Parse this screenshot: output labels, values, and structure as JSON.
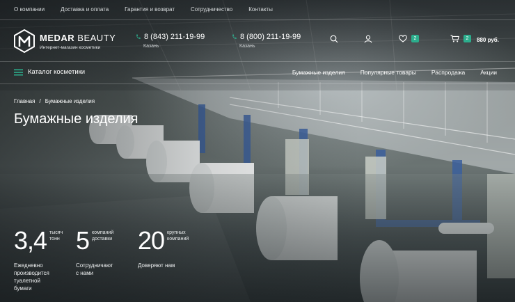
{
  "toplinks": [
    "О компании",
    "Доставка и оплата",
    "Гарантия и возврат",
    "Сотрудничество",
    "Контакты"
  ],
  "logo": {
    "name_bold": "MEDAR",
    "name_light": "BEAUTY",
    "tagline": "Интернет-магазин косметики"
  },
  "phones": [
    {
      "number": "8 (843) 211-19-99",
      "city": "Казань"
    },
    {
      "number": "8 (800) 211-19-99",
      "city": "Казань"
    }
  ],
  "header_icons": {
    "search": "search-icon",
    "account": "user-icon",
    "wishlist": "heart-icon",
    "cart": "cart-icon",
    "wishlist_count": "2",
    "cart_count": "2",
    "cart_total": "880 руб."
  },
  "catalog_label": "Каталог косметики",
  "nav": [
    "Бумажные изделия",
    "Популярные товары",
    "Распродажа",
    "Акции"
  ],
  "breadcrumb": {
    "home": "Главная",
    "separator": "/",
    "current": "Бумажные изделия"
  },
  "page_title": "Бумажные изделия",
  "stats": [
    {
      "value": "3,4",
      "unit": [
        "тысяч",
        "тонн"
      ],
      "desc": [
        "Ежедневно",
        "производится",
        "туалетной",
        "бумаги"
      ]
    },
    {
      "value": "5",
      "unit": [
        "компаний",
        "доставки"
      ],
      "desc": [
        "Сотрудничают",
        "с нами"
      ]
    },
    {
      "value": "20",
      "unit": [
        "крупных",
        "компаний"
      ],
      "desc": [
        "Доверяют нам"
      ]
    }
  ],
  "colors": {
    "accent": "#2cae8d",
    "text": "#ffffff"
  }
}
